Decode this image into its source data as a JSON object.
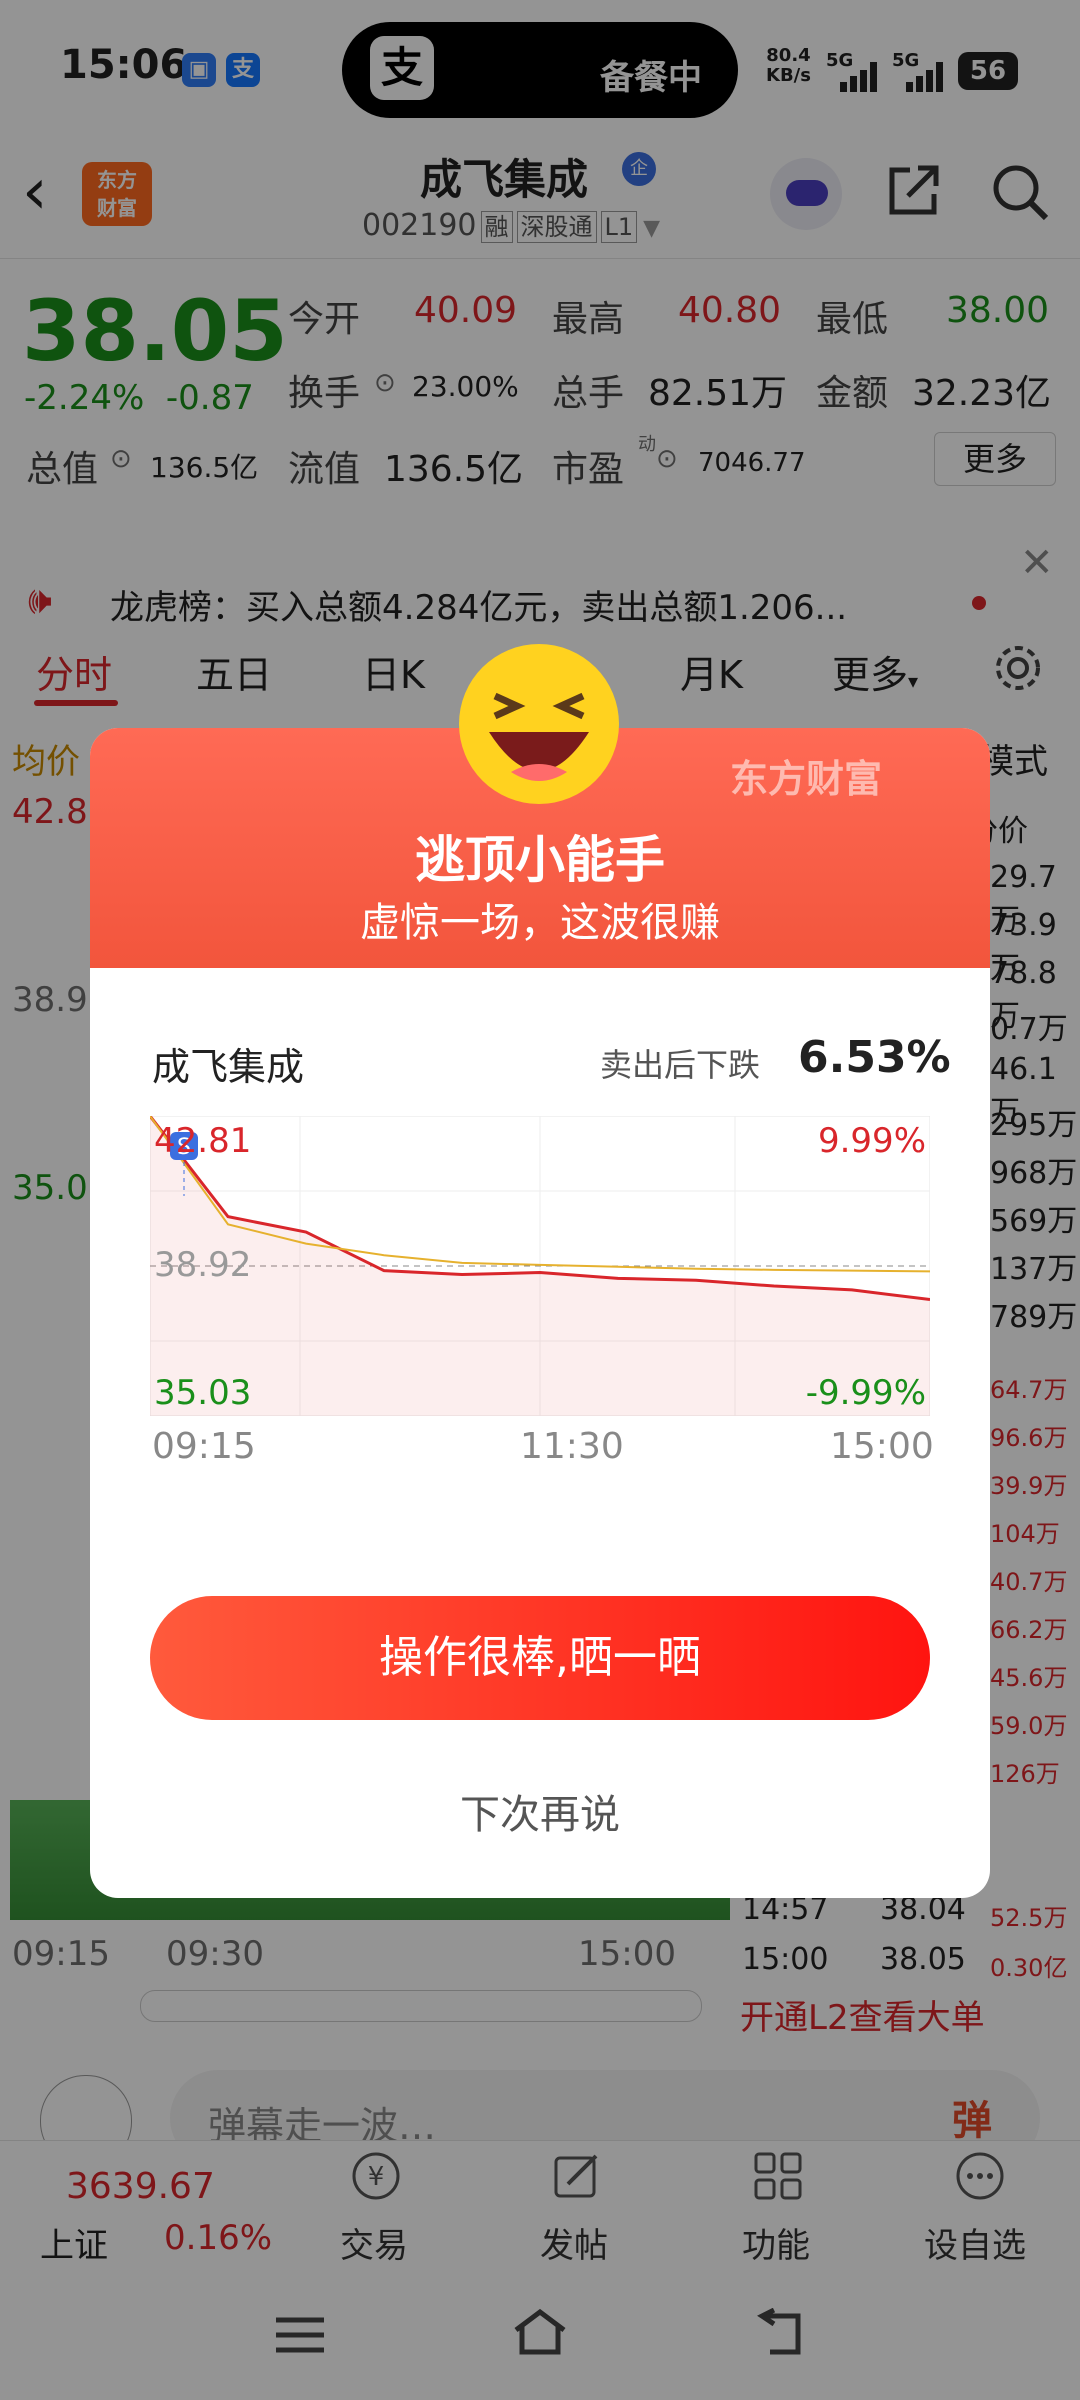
{
  "status_bar": {
    "time": "15:06",
    "pill_text": "备餐中",
    "pill_icon": "支",
    "app_icon_2": "支",
    "net_speed": "80.4",
    "net_unit": "KB/s",
    "signal1": "5G",
    "signal2": "5G",
    "battery": "56"
  },
  "header": {
    "logo_line1": "东方",
    "logo_line2": "财富",
    "stock_name": "成飞集成",
    "badge": "企",
    "code": "002190",
    "tags": [
      "融",
      "深股通",
      "L1"
    ]
  },
  "quote": {
    "price": "38.05",
    "change_pct": "-2.24%",
    "change_abs": "-0.87",
    "open_label": "今开",
    "open": "40.09",
    "high_label": "最高",
    "high": "40.80",
    "low_label": "最低",
    "low": "38.00",
    "turnover_label": "换手",
    "turnover": "23.00%",
    "volume_label": "总手",
    "volume": "82.51万",
    "amount_label": "金额",
    "amount": "32.23亿",
    "mktcap_label": "总值",
    "mktcap": "136.5亿",
    "float_label": "流值",
    "float": "136.5亿",
    "pe_label": "市盈",
    "pe_sup": "动",
    "pe": "7046.77",
    "more": "更多"
  },
  "news": {
    "text": "龙虎榜：买入总额4.284亿元，卖出总额1.206..."
  },
  "tabs": {
    "items": [
      "分时",
      "五日",
      "日K",
      "月K",
      "更多"
    ],
    "active": "分时",
    "mode": "模式"
  },
  "background": {
    "avg_label": "均价",
    "left_vals": [
      "42.8",
      "38.9",
      "35.0"
    ],
    "col_label": "分价",
    "right_vals": [
      "29.7万",
      "73.9万",
      "78.8万",
      "0.7万",
      "46.1万",
      "295万",
      "968万",
      "569万",
      "137万",
      "789万",
      "64.7万",
      "96.6万",
      "39.9万",
      "104万",
      "40.7万",
      "66.2万",
      "45.6万",
      "59.0万",
      "126万"
    ],
    "time_labels": [
      "09:15",
      "09:30",
      "15:00"
    ],
    "trades": [
      {
        "t": "14:57",
        "p": "38.04",
        "v": "52.5万"
      },
      {
        "t": "15:00",
        "p": "38.05",
        "v": "0.30亿"
      }
    ],
    "open_l2": "开通L2查看大单"
  },
  "comment": {
    "placeholder": "弹幕走一波…",
    "danmu": "弹"
  },
  "nav": {
    "index_value": "3639.67",
    "index_name": "上证",
    "index_pct": "0.16%",
    "items": [
      {
        "label": "交易"
      },
      {
        "label": "发帖"
      },
      {
        "label": "功能"
      },
      {
        "label": "设自选"
      }
    ]
  },
  "dialog": {
    "brand": "东方财富",
    "title": "逃顶小能手",
    "subtitle": "虚惊一场，这波很赚",
    "stock": "成飞集成",
    "drop_label": "卖出后下跌",
    "drop_value": "6.53%",
    "chart_high": "42.81",
    "chart_mid": "38.92",
    "chart_low": "35.03",
    "chart_up_pct": "9.99%",
    "chart_down_pct": "-9.99%",
    "sell_marker": "S",
    "times": [
      "09:15",
      "11:30",
      "15:00"
    ],
    "share_btn": "操作很棒,晒一晒",
    "later_btn": "下次再说"
  },
  "chart_data": {
    "type": "line",
    "title": "",
    "xlabel": "",
    "ylabel": "",
    "x": [
      "09:15",
      "09:30",
      "09:45",
      "10:00",
      "10:30",
      "11:00",
      "11:30",
      "13:30",
      "14:00",
      "14:30",
      "15:00"
    ],
    "series": [
      {
        "values": [
          42.81,
          40.2,
          39.8,
          38.8,
          38.7,
          38.75,
          38.6,
          38.55,
          38.4,
          38.3,
          38.05
        ]
      },
      {
        "values": [
          42.81,
          40.0,
          39.5,
          39.2,
          39.0,
          38.95,
          38.9,
          38.85,
          38.82,
          38.8,
          38.78
        ]
      }
    ],
    "ylim": [
      35.03,
      42.81
    ],
    "reference_line": 38.92
  }
}
